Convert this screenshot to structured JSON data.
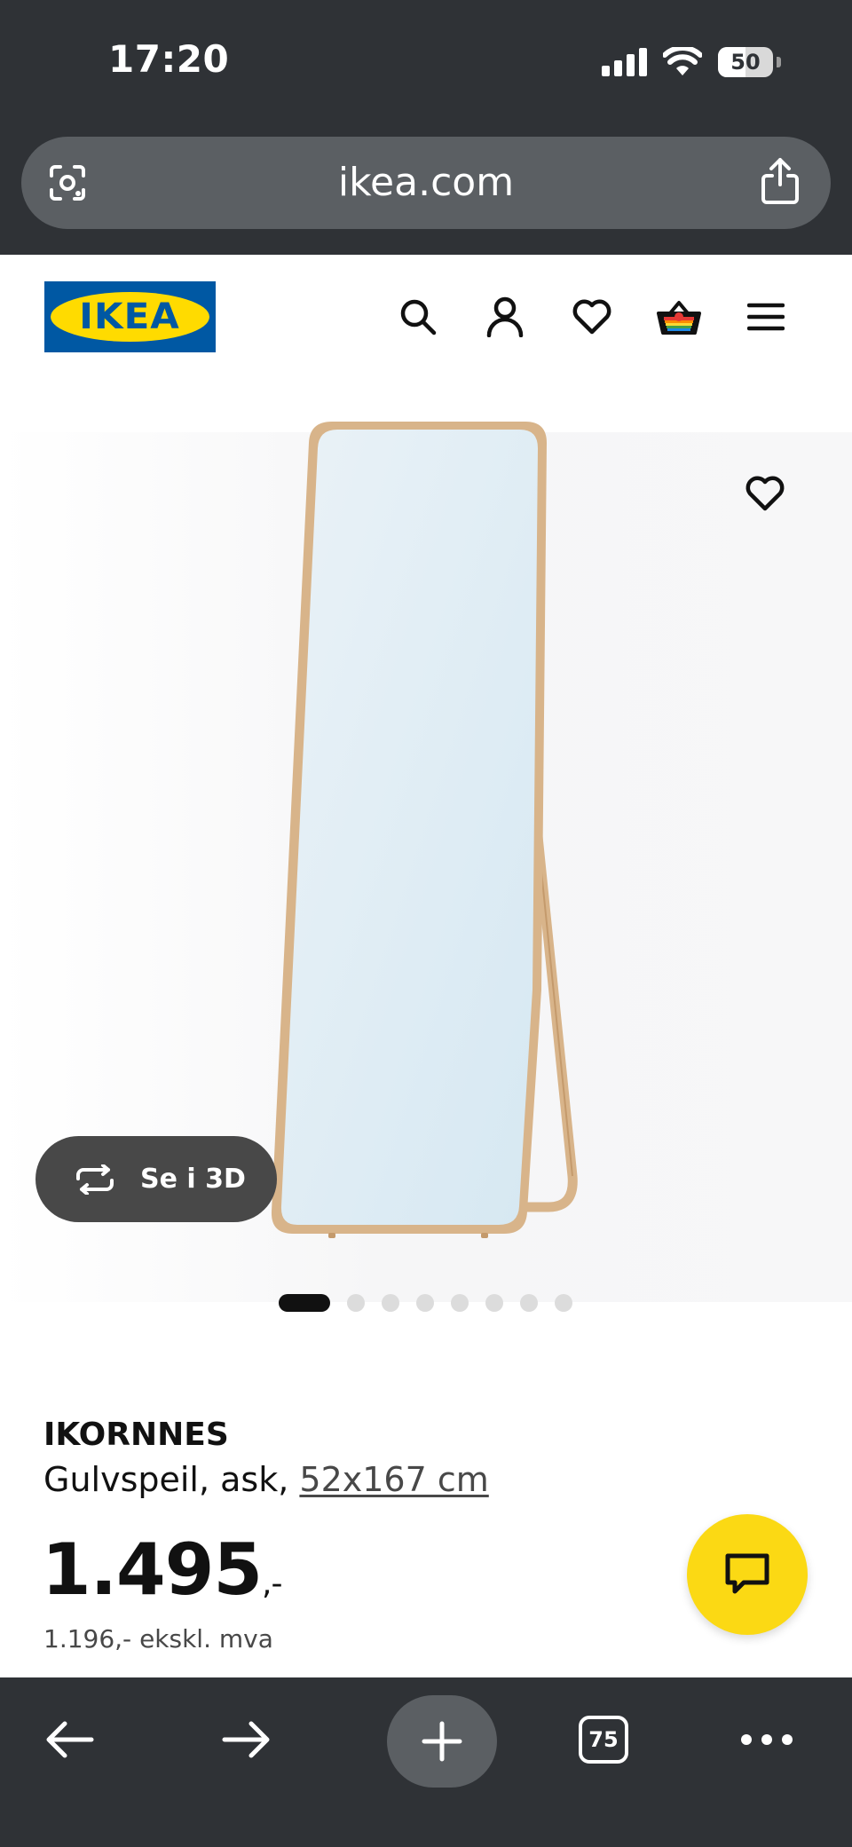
{
  "status_bar": {
    "time": "17:20",
    "battery_level": "50",
    "battery_fraction": 0.5,
    "icons": [
      "cellular-signal-icon",
      "wifi-icon",
      "battery-icon"
    ]
  },
  "browser": {
    "url": "ikea.com",
    "icons": [
      "lens-icon",
      "share-icon"
    ],
    "toolbar": {
      "tabs_count": "75",
      "icons": [
        "back-arrow-icon",
        "forward-arrow-icon",
        "new-tab-plus-icon",
        "tabs-icon",
        "more-dots-icon"
      ]
    }
  },
  "site_header": {
    "logo_text": "IKEA",
    "icons": [
      "search-icon",
      "account-icon",
      "favorites-heart-icon",
      "shopping-basket-icon",
      "hamburger-menu-icon"
    ]
  },
  "gallery": {
    "view_3d_label": "Se i 3D",
    "image_count": 8,
    "active_index": 0,
    "icons": [
      "favorite-heart-icon",
      "rotate-3d-icon"
    ]
  },
  "product": {
    "name": "IKORNNES",
    "description": "Gulvspeil, ask, ",
    "dimensions": "52x167 cm",
    "price_main": "1.495",
    "price_suffix": ",-",
    "price_ex_vat": "1.196,- ekskl. mva"
  },
  "chat": {
    "icon": "chat-bubble-icon"
  },
  "colors": {
    "chrome_bg": "#2f3236",
    "urlbar_bg": "#5b5f63",
    "ikea_blue": "#0058a3",
    "ikea_yellow": "#ffdb00",
    "chat_yellow": "#fbd914",
    "button_3d_bg": "#484848",
    "mirror_frame": "#d8b48a",
    "mirror_glass": "#dbe9f2"
  }
}
